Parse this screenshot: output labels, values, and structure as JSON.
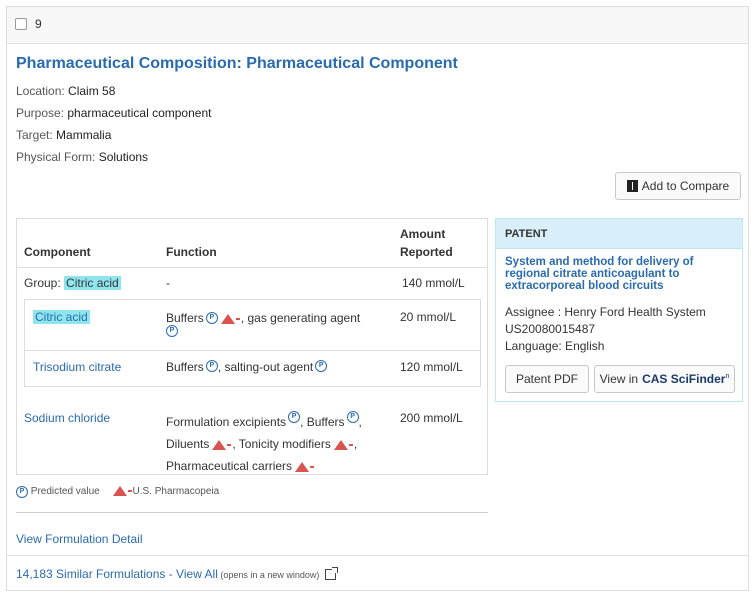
{
  "header": {
    "number": "9"
  },
  "title": "Pharmaceutical Composition: Pharmaceutical Component",
  "meta": {
    "location_label": "Location: ",
    "location": "Claim 58",
    "purpose_label": "Purpose: ",
    "purpose": "pharmaceutical component",
    "target_label": "Target: ",
    "target": "Mammalia",
    "form_label": "Physical Form: ",
    "form": "Solutions"
  },
  "compare_button": "Add to Compare",
  "table": {
    "headers": {
      "component": "Component",
      "function": "Function",
      "amount1": "Amount",
      "amount2": "Reported"
    },
    "group": {
      "label": "Group: ",
      "name": "Citric acid",
      "function": "-",
      "amount": "140 mmol/L"
    },
    "rows": [
      {
        "name": "Citric acid",
        "f1": "Buffers",
        "f2": ", gas generating agent",
        "amount": "20 mmol/L"
      },
      {
        "name": "Trisodium citrate",
        "f1": "Buffers",
        "f2": ", salting-out agent",
        "amount": "120 mmol/L"
      },
      {
        "name": "Sodium chloride",
        "f1": "Formulation excipients",
        "f2": ", Buffers",
        "f3": ",",
        "f4": "Diluents",
        "f5": ", Tonicity modifiers",
        "f6": ",",
        "f7": "Pharmaceutical carriers",
        "amount": "200 mmol/L"
      }
    ]
  },
  "legend": {
    "predicted": "Predicted value",
    "usp": "U.S. Pharmacopeia"
  },
  "view_detail": "View Formulation Detail",
  "footer": {
    "link": "14,183 Similar Formulations - View All",
    "note": " (opens in a new window)"
  },
  "patent": {
    "heading": "PATENT",
    "title": "System and method for delivery of regional citrate anticoagulant to extracorporeal blood circuits",
    "assignee": "Assignee : Henry Ford Health System",
    "number": "US20080015487",
    "language": "Language: English",
    "pdf_button": "Patent PDF",
    "view_label": "View in",
    "cas_label": "CAS SciFinder",
    "cas_sup": "n"
  },
  "icons": {
    "predicted": "circled-p-icon",
    "usp": "usp-triangle-icon",
    "compare": "book-icon",
    "external": "external-window-icon"
  },
  "colors": {
    "link": "#2a6bb0",
    "highlight": "#8fe5ee",
    "usp": "#d9534f",
    "patent_header": "#d8eff9"
  }
}
